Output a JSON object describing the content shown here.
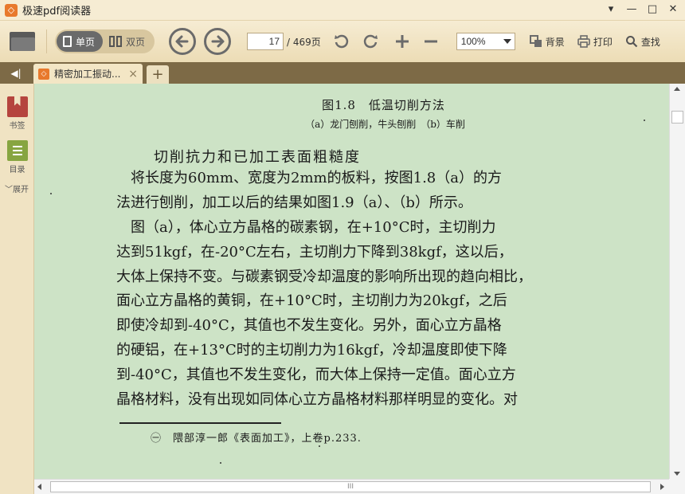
{
  "app": {
    "title": "极速pdf阅读器",
    "logo_glyph": "◇",
    "window_controls": [
      "▾",
      "—",
      "□",
      "✕"
    ]
  },
  "toolbar": {
    "single_page_label": "单页",
    "dual_page_label": "双页",
    "current_page": "17",
    "total_pages": "/ 469页",
    "zoom": "100%",
    "background_label": "背景",
    "print_label": "打印",
    "search_label": "查找"
  },
  "tabs": {
    "sidebar_toggle_glyph": "◀|",
    "items": [
      {
        "title": "精密加工振动...",
        "close": "×"
      }
    ],
    "add_glyph": "+"
  },
  "sidebar": {
    "bookmark_label": "书签",
    "toc_label": "目录",
    "expand_label": "展开"
  },
  "page": {
    "figure_caption": "图1.8　低温切削方法",
    "figure_subcaption": "（a）龙门刨削，牛头刨削　（b）车削",
    "section_title": "切削抗力和已加工表面粗糙度",
    "paragraph1": [
      "　将长度为60mm、宽度为2mm的板料，按图1.8（a）的方",
      "法进行刨削，加工以后的结果如图1.9（a）、（b）所示。"
    ],
    "paragraph2": [
      "　图（a），体心立方晶格的碳素钢，在+10°C时，主切削力",
      "达到51kgf，在-20°C左右，主切削力下降到38kgf，这以后，",
      "大体上保持不变。与碳素钢受冷却温度的影响所出现的趋向相比，",
      "面心立方晶格的黄铜，在+10°C时，主切削力为20kgf，之后",
      "即使冷却到-40°C，其值也不发生变化。另外，面心立方晶格",
      "的硬铝，在+13°C时的主切削力为16kgf，冷却温度即使下降",
      "到-40°C，其值也不发生变化，而大体上保持一定值。面心立方",
      "晶格材料，没有出现如同体心立方晶格材料那样明显的变化。对"
    ],
    "footnote": "㊀　隈部淳一郎《表面加工》，上卷p.233."
  },
  "scrollbar": {
    "grip": "III"
  },
  "colors": {
    "page_background": "#cde3c6",
    "tab_bar": "#7d6a46",
    "toolbar": "#f1e4c4",
    "accent_orange": "#e8792c",
    "bookmark_red": "#b5443e",
    "toc_green": "#87a541"
  }
}
